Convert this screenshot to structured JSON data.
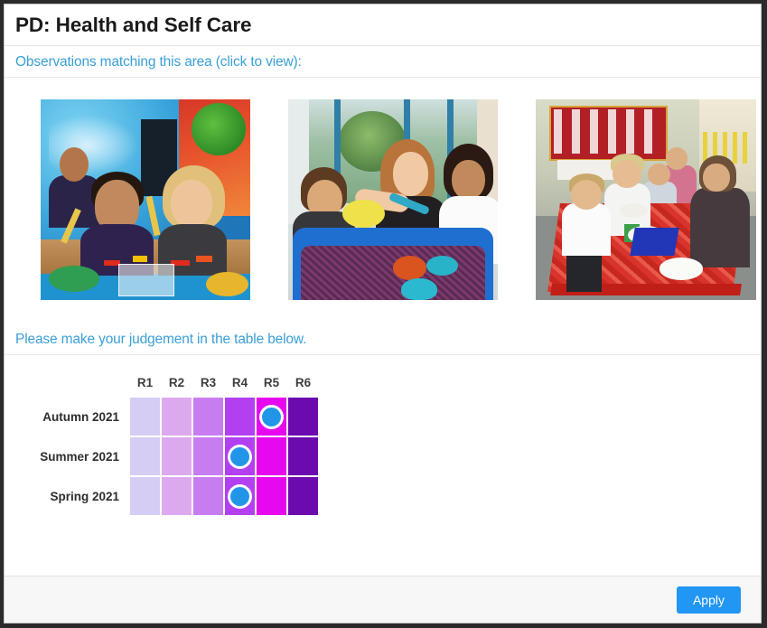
{
  "page": {
    "title": "PD: Health and Self Care"
  },
  "observations": {
    "heading": "Observations matching this area (click to view):",
    "photos": [
      {
        "alt": "Two young children at a craft table with toy hammers and coloured shapes",
        "name": "observation-photo-1"
      },
      {
        "alt": "Teacher and two children exploring a blue sensory tuff tray with bowls and tongs",
        "name": "observation-photo-2"
      },
      {
        "alt": "Children and an adult seated at a red snack table with plates and a strawberry tablecloth",
        "name": "observation-photo-3"
      }
    ]
  },
  "judgement": {
    "heading": "Please make your judgement in the table below.",
    "columns": [
      "R1",
      "R2",
      "R3",
      "R4",
      "R5",
      "R6"
    ],
    "column_colors": [
      "#d6cdf4",
      "#dda9ee",
      "#c77df0",
      "#b23ff0",
      "#e609f0",
      "#6a0aaf"
    ],
    "rows": [
      {
        "label": "Autumn 2021",
        "selected": "R5"
      },
      {
        "label": "Summer 2021",
        "selected": "R4"
      },
      {
        "label": "Spring 2021",
        "selected": "R4"
      }
    ],
    "marker_color": "#2196e8",
    "marker_ring_color": "#ffffff"
  },
  "footer": {
    "apply_label": "Apply",
    "apply_color": "#2196f3"
  },
  "theme": {
    "heading_blue": "#3a9fd6",
    "title_color": "#1a1a1a",
    "frame_color": "#2b2b2b"
  }
}
